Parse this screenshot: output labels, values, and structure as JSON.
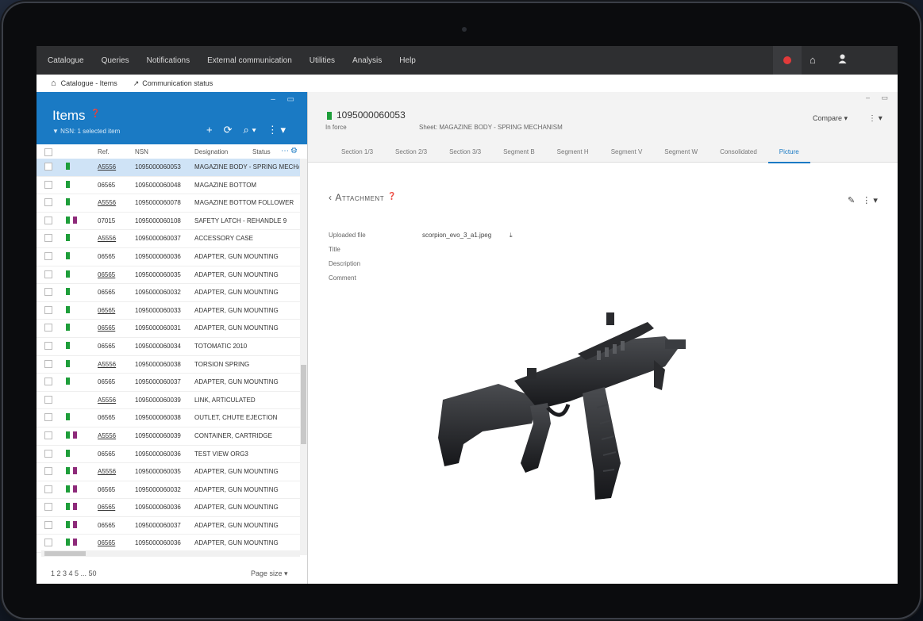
{
  "nav": {
    "menu": [
      "Catalogue",
      "Queries",
      "Notifications",
      "External communication",
      "Utilities",
      "Analysis",
      "Help"
    ],
    "icons": [
      "bell-icon",
      "home-icon",
      "user-icon"
    ]
  },
  "breadcrumb": {
    "items": [
      "Catalogue - Items",
      "Communication status"
    ]
  },
  "items_panel": {
    "title": "Items",
    "filter_text": "NSN: 1 selected item",
    "columns": [
      "Ref.",
      "NSN",
      "Designation",
      "Status"
    ],
    "rows": [
      {
        "ref": "A5556",
        "nsn": "1095000060053",
        "desc": "MAGAZINE BODY - SPRING MECHANISM",
        "flags": [
          "green"
        ],
        "selected": true,
        "underline": true
      },
      {
        "ref": "06565",
        "nsn": "1095000060048",
        "desc": "MAGAZINE BOTTOM",
        "flags": [
          "green"
        ],
        "selected": false,
        "underline": false
      },
      {
        "ref": "A5556",
        "nsn": "1095000060078",
        "desc": "MAGAZINE BOTTOM FOLLOWER",
        "flags": [
          "green"
        ],
        "selected": false,
        "underline": true
      },
      {
        "ref": "07015",
        "nsn": "1095000060108",
        "desc": "SAFETY LATCH - REHANDLE 9",
        "flags": [
          "green",
          "purple"
        ],
        "selected": false,
        "underline": false
      },
      {
        "ref": "A5556",
        "nsn": "1095000060037",
        "desc": "ACCESSORY CASE",
        "flags": [
          "green"
        ],
        "selected": false,
        "underline": true
      },
      {
        "ref": "06565",
        "nsn": "1095000060036",
        "desc": "ADAPTER, GUN MOUNTING",
        "flags": [
          "green"
        ],
        "selected": false,
        "underline": false
      },
      {
        "ref": "06565",
        "nsn": "1095000060035",
        "desc": "ADAPTER, GUN MOUNTING",
        "flags": [
          "green"
        ],
        "selected": false,
        "underline": true
      },
      {
        "ref": "06565",
        "nsn": "1095000060032",
        "desc": "ADAPTER, GUN MOUNTING",
        "flags": [
          "green"
        ],
        "selected": false,
        "underline": false
      },
      {
        "ref": "06565",
        "nsn": "1095000060033",
        "desc": "ADAPTER, GUN MOUNTING",
        "flags": [
          "green"
        ],
        "selected": false,
        "underline": true
      },
      {
        "ref": "06565",
        "nsn": "1095000060031",
        "desc": "ADAPTER, GUN MOUNTING",
        "flags": [
          "green"
        ],
        "selected": false,
        "underline": true
      },
      {
        "ref": "06565",
        "nsn": "1095000060034",
        "desc": "TOTOMATIC 2010",
        "flags": [
          "green"
        ],
        "selected": false,
        "underline": false
      },
      {
        "ref": "A5556",
        "nsn": "1095000060038",
        "desc": "TORSION SPRING",
        "flags": [
          "green"
        ],
        "selected": false,
        "underline": true
      },
      {
        "ref": "06565",
        "nsn": "1095000060037",
        "desc": "ADAPTER, GUN MOUNTING",
        "flags": [
          "green"
        ],
        "selected": false,
        "underline": false
      },
      {
        "ref": "A5556",
        "nsn": "1095000060039",
        "desc": "LINK, ARTICULATED",
        "flags": [],
        "selected": false,
        "underline": true
      },
      {
        "ref": "06565",
        "nsn": "1095000060038",
        "desc": "OUTLET, CHUTE EJECTION",
        "flags": [
          "green"
        ],
        "selected": false,
        "underline": false
      },
      {
        "ref": "A5556",
        "nsn": "1095000060039",
        "desc": "CONTAINER, CARTRIDGE",
        "flags": [
          "green",
          "purple"
        ],
        "selected": false,
        "underline": true
      },
      {
        "ref": "06565",
        "nsn": "1095000060036",
        "desc": "TEST VIEW ORG3",
        "flags": [
          "green"
        ],
        "selected": false,
        "underline": false
      },
      {
        "ref": "A5556",
        "nsn": "1095000060035",
        "desc": "ADAPTER, GUN MOUNTING",
        "flags": [
          "green",
          "purple"
        ],
        "selected": false,
        "underline": true
      },
      {
        "ref": "06565",
        "nsn": "1095000060032",
        "desc": "ADAPTER, GUN MOUNTING",
        "flags": [
          "green",
          "purple"
        ],
        "selected": false,
        "underline": false
      },
      {
        "ref": "06565",
        "nsn": "1095000060036",
        "desc": "ADAPTER, GUN MOUNTING",
        "flags": [
          "green",
          "purple"
        ],
        "selected": false,
        "underline": true
      },
      {
        "ref": "06565",
        "nsn": "1095000060037",
        "desc": "ADAPTER, GUN MOUNTING",
        "flags": [
          "green",
          "purple"
        ],
        "selected": false,
        "underline": false
      },
      {
        "ref": "06565",
        "nsn": "1095000060036",
        "desc": "ADAPTER, GUN MOUNTING",
        "flags": [
          "green",
          "purple"
        ],
        "selected": false,
        "underline": true
      }
    ],
    "pagination": "1 2 3 4 5 ... 50",
    "page_size": "Page size"
  },
  "detail": {
    "code": "1095000060053",
    "status": "In force",
    "description": "Sheet: MAGAZINE BODY - SPRING MECHANISM",
    "compare_label": "Compare",
    "tabs": [
      "Section 1/3",
      "Section 2/3",
      "Section 3/3",
      "Segment B",
      "Segment H",
      "Segment V",
      "Segment W",
      "Consolidated",
      "Picture"
    ],
    "active_tab": 8,
    "attachment": {
      "title": "Attachment",
      "fields": [
        {
          "label": "Uploaded file",
          "value": "scorpion_evo_3_a1.jpeg"
        },
        {
          "label": "Title",
          "value": ""
        },
        {
          "label": "Description",
          "value": ""
        },
        {
          "label": "Comment",
          "value": ""
        }
      ]
    }
  },
  "colors": {
    "accent": "#1a7ac4",
    "nav_bg": "#2e2f31",
    "flag_green": "#1e9e3a",
    "flag_purple": "#8e2a7a",
    "alert": "#e23a3a"
  }
}
